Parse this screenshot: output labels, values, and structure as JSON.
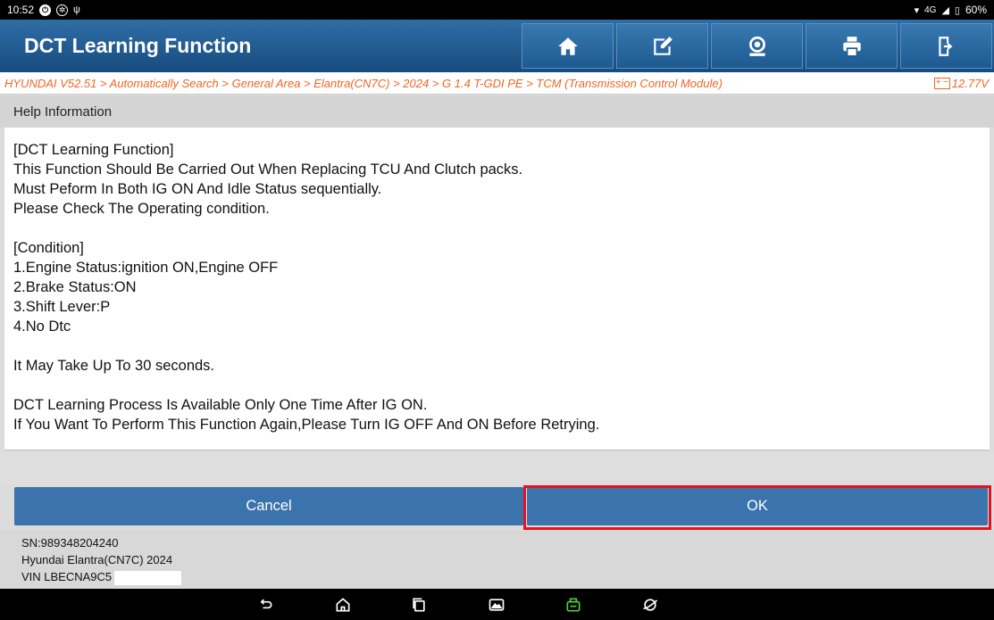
{
  "status_bar": {
    "time": "10:52",
    "network": "4G",
    "battery": "60%"
  },
  "header": {
    "title": "DCT Learning Function",
    "toolbar": [
      {
        "icon": "home-icon"
      },
      {
        "icon": "edit-report-icon"
      },
      {
        "icon": "remote-support-icon"
      },
      {
        "icon": "print-icon"
      },
      {
        "icon": "exit-icon"
      }
    ]
  },
  "breadcrumb": {
    "path": "HYUNDAI V52.51 > Automatically Search > General Area > Elantra(CN7C) > 2024 > G 1.4 T-GDI PE > TCM (Transmission Control Module)",
    "voltage": "12.77V"
  },
  "help": {
    "header": "Help Information",
    "lines": {
      "l1": "[DCT Learning Function]",
      "l2": "This Function Should Be Carried Out When Replacing TCU And Clutch packs.",
      "l3": "Must Peform In Both IG ON And Idle Status sequentially.",
      "l4": "Please Check The Operating condition.",
      "l5": "[Condition]",
      "l6": "1.Engine Status:ignition ON,Engine OFF",
      "l7": "2.Brake Status:ON",
      "l8": "3.Shift Lever:P",
      "l9": "4.No Dtc",
      "l10": "It May Take Up To 30 seconds.",
      "l11": "DCT Learning Process Is Available Only One Time After IG ON.",
      "l12": "If You Want To Perform This Function Again,Please Turn IG OFF And ON Before Retrying."
    }
  },
  "buttons": {
    "cancel": "Cancel",
    "ok": "OK"
  },
  "footer": {
    "sn": "SN:989348204240",
    "vehicle": "Hyundai Elantra(CN7C) 2024",
    "vin": "VIN LBECNA9C5"
  },
  "colors": {
    "accent": "#2a6aa5",
    "breadcrumb": "#f26522",
    "highlight": "#e4121f"
  }
}
